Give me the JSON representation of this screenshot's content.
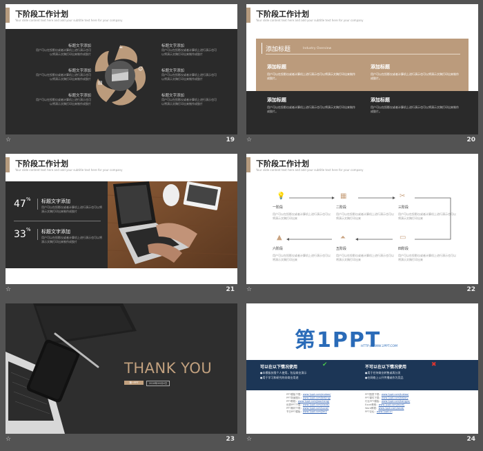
{
  "slides": [
    {
      "num": "19",
      "title": "下阶段工作计划",
      "subtitle": "Your slide content text here and add your subtitle text here for your company",
      "items": [
        {
          "label": "标题文字添加",
          "text": "用户可以在投影仪或者计算机上进行演示也可以将演示文稿打印出来制作成胶片"
        },
        {
          "label": "标题文字添加",
          "text": "用户可以在投影仪或者计算机上进行演示也可以将演示文稿打印出来制作成胶片"
        },
        {
          "label": "标题文字添加",
          "text": "用户可以在投影仪或者计算机上进行演示也可以将演示文稿打印出来制作成胶片"
        },
        {
          "label": "标题文字添加",
          "text": "用户可以在投影仪或者计算机上进行演示也可以将演示文稿打印出来制作成胶片"
        },
        {
          "label": "标题文字添加",
          "text": "用户可以在投影仪或者计算机上进行演示也可以将演示文稿打印出来制作成胶片"
        },
        {
          "label": "标题文字添加",
          "text": "用户可以在投影仪或者计算机上进行演示也可以将演示文稿打印出来制作成胶片"
        }
      ]
    },
    {
      "num": "20",
      "title": "下阶段工作计划",
      "subtitle": "Your slide content text here and add your subtitle text here for your company",
      "band_title": "添加标题",
      "band_sub": "Industry Overview",
      "blocks": [
        {
          "title": "添加标题",
          "text": "用户可以在投影仪或者计算机上进行演示也可以将演示文稿打印出来制作成胶片。"
        },
        {
          "title": "添加标题",
          "text": "用户可以在投影仪或者计算机上进行演示也可以将演示文稿打印出来制作成胶片。"
        },
        {
          "title": "添加标题",
          "text": "用户可以在投影仪或者计算机上进行演示也可以将演示文稿打印出来制作成胶片。"
        },
        {
          "title": "添加标题",
          "text": "用户可以在投影仪或者计算机上进行演示也可以将演示文稿打印出来制作成胶片。"
        }
      ]
    },
    {
      "num": "21",
      "title": "下阶段工作计划",
      "subtitle": "Your slide content text here and add your subtitle text here for your company",
      "stats": [
        {
          "value": "47",
          "unit": "%",
          "label": "标题文字添加",
          "text": "用户可以在投影仪或者计算机上进行演示也可以将演示文稿打印出来制作成胶片"
        },
        {
          "value": "33",
          "unit": "%",
          "label": "标题文字添加",
          "text": "用户可以在投影仪或者计算机上进行演示也可以将演示文稿打印出来制作成胶片"
        }
      ]
    },
    {
      "num": "22",
      "title": "下阶段工作计划",
      "subtitle": "Your slide content text here and add your subtitle text here for your company",
      "stages": [
        {
          "label": "一阶段",
          "text": "用户可以在投影仪或者计算机上进行演示也可以将演示文稿打印出来"
        },
        {
          "label": "二阶段",
          "text": "用户可以在投影仪或者计算机上进行演示也可以将演示文稿打印出来"
        },
        {
          "label": "三阶段",
          "text": "用户可以在投影仪或者计算机上进行演示也可以将演示文稿打印出来"
        },
        {
          "label": "四阶段",
          "text": "用户可以在投影仪或者计算机上进行演示也可以将演示文稿打印出来"
        },
        {
          "label": "五阶段",
          "text": "用户可以在投影仪或者计算机上进行演示也可以将演示文稿打印出来"
        },
        {
          "label": "六阶段",
          "text": "用户可以在投影仪或者计算机上进行演示也可以将演示文稿打印出来"
        }
      ]
    },
    {
      "num": "23",
      "thank_you": "THANK YOU",
      "tag1": "第一PPT",
      "tag2": "2018年XX月X日"
    },
    {
      "num": "24",
      "logo_main": "第1PPT",
      "logo_url": "HTTP://WWW.1PPT.COM",
      "can_title": "可以在以下情况使用",
      "can_items": [
        "●本模板仅限个人使用，包括商业演示",
        "●用于学习和研究的非商业用途"
      ],
      "cannot_title": "不可以在以下情况使用",
      "cannot_items": [
        "●用于任何商业转售或再分发",
        "●在网络上公开传播或作为竞品"
      ],
      "links": [
        {
          "label": "PPT模板下载：",
          "url": "www.1ppt.com/moban/"
        },
        {
          "label": "PPT背景图片：",
          "url": "www.1ppt.com/beijing/"
        },
        {
          "label": "PPT教程：",
          "url": "www.1ppt.com/jiaocheng/"
        },
        {
          "label": "优秀PPT下载：",
          "url": "www.1ppt.com/xiazai/"
        },
        {
          "label": "PPT素材下载：",
          "url": "www.1ppt.com/sucai/"
        },
        {
          "label": "节日PPT模板：",
          "url": "www.1ppt.com/jieri/"
        },
        {
          "label": "PPT图表下载：",
          "url": "www.1ppt.com/tubiao/"
        },
        {
          "label": "PPT课件下载：",
          "url": "www.1ppt.com/kejian/"
        },
        {
          "label": "行业PPT模板：",
          "url": "www.1ppt.com/hangye/"
        },
        {
          "label": "Excel教程：",
          "url": "www.1ppt.com/excel/"
        },
        {
          "label": "Word教程：",
          "url": "www.1ppt.com/word/"
        },
        {
          "label": "PPT论坛：",
          "url": "www.1ppt.cn"
        }
      ]
    }
  ],
  "colors": {
    "accent": "#b69b7e",
    "dark": "#2a2a2a",
    "navy": "#1c3656",
    "logo_blue": "#2a6bb8",
    "logo_orange": "#f08a1d"
  }
}
